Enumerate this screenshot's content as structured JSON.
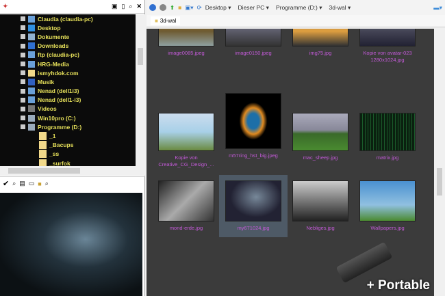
{
  "tree": {
    "items": [
      {
        "label": "Claudia (claudia-pc)",
        "icon": "network-computer-icon",
        "color": "#6aa0d8"
      },
      {
        "label": "Desktop",
        "icon": "desktop-icon",
        "color": "#2f8fe0"
      },
      {
        "label": "Dokumente",
        "icon": "documents-icon",
        "color": "#8fb0d0"
      },
      {
        "label": "Downloads",
        "icon": "downloads-icon",
        "color": "#3070d0"
      },
      {
        "label": "ftp (claudia-pc)",
        "icon": "network-computer-icon",
        "color": "#6aa0d8"
      },
      {
        "label": "HRG-Media",
        "icon": "network-computer-icon",
        "color": "#6aa0d8"
      },
      {
        "label": "ismyhdok.com",
        "icon": "folder-icon",
        "color": "#f2d98a"
      },
      {
        "label": "Musik",
        "icon": "music-icon",
        "color": "#3060c0"
      },
      {
        "label": "Nenad (dell1i3)",
        "icon": "network-computer-icon",
        "color": "#6aa0d8"
      },
      {
        "label": "Nenad (dell1-i3)",
        "icon": "network-computer-icon",
        "color": "#6aa0d8"
      },
      {
        "label": "Videos",
        "icon": "videos-icon",
        "color": "#777777"
      },
      {
        "label": "Win10pro (C:)",
        "icon": "drive-icon",
        "color": "#9ab"
      },
      {
        "label": "Programme (D:)",
        "icon": "drive-icon",
        "color": "#9ab"
      }
    ],
    "sub": [
      "_1",
      "_Bacups",
      "_ss",
      "_surfok"
    ]
  },
  "address": {
    "crumbs": [
      "Desktop",
      "Dieser PC",
      "Programme (D:)",
      "3d-wal"
    ]
  },
  "tab": {
    "label": "3d-wal"
  },
  "files": [
    {
      "name": "image0085.jpeg",
      "bg": "linear-gradient(#c9a050,#6e5a30 60%,#8fa0a0)"
    },
    {
      "name": "image0150.jpeg",
      "bg": "linear-gradient(#222,#667 50%,#333)"
    },
    {
      "name": "img75.jpg",
      "bg": "linear-gradient(#555,#e0a040 60%,#333)"
    },
    {
      "name": "Kopie von avatar-023 1280x1024.jpg",
      "bg": "linear-gradient(#8fa0a8,#445 60%,#223)"
    },
    {
      "name": "Kopie von Creative_CG_Design_...",
      "bg": "linear-gradient(#cde,#a8d0e8 50%,#6a8a40)"
    },
    {
      "name": "m57ring_hst_big.jpeg",
      "bg": "radial-gradient(ellipse 30% 40%,#1d6fa8 35%,#e08a20 60%,#000 85%)"
    },
    {
      "name": "mac_sheep.jpg",
      "bg": "linear-gradient(#aab,#889 45%,#3a6a2a 55%,#4a8a30)"
    },
    {
      "name": "matrix.jpg",
      "bg": "repeating-linear-gradient(90deg,#0a200f 0 3px,#1a5a2a 3px 4px)"
    },
    {
      "name": "mond-erde.jpg",
      "bg": "linear-gradient(135deg,#222,#aaa 50%,#333)"
    },
    {
      "name": "my671024.jpg",
      "bg": "radial-gradient(ellipse at 55% 40%,#789,#223 60%)"
    },
    {
      "name": "Nebliges.jpg",
      "bg": "linear-gradient(#ccc,#777 50%,#222)"
    },
    {
      "name": "Wallpapers.jpg",
      "bg": "linear-gradient(#4a90d0,#90c0e0 60%,#4a8a30)"
    }
  ],
  "portable": "+ Portable"
}
